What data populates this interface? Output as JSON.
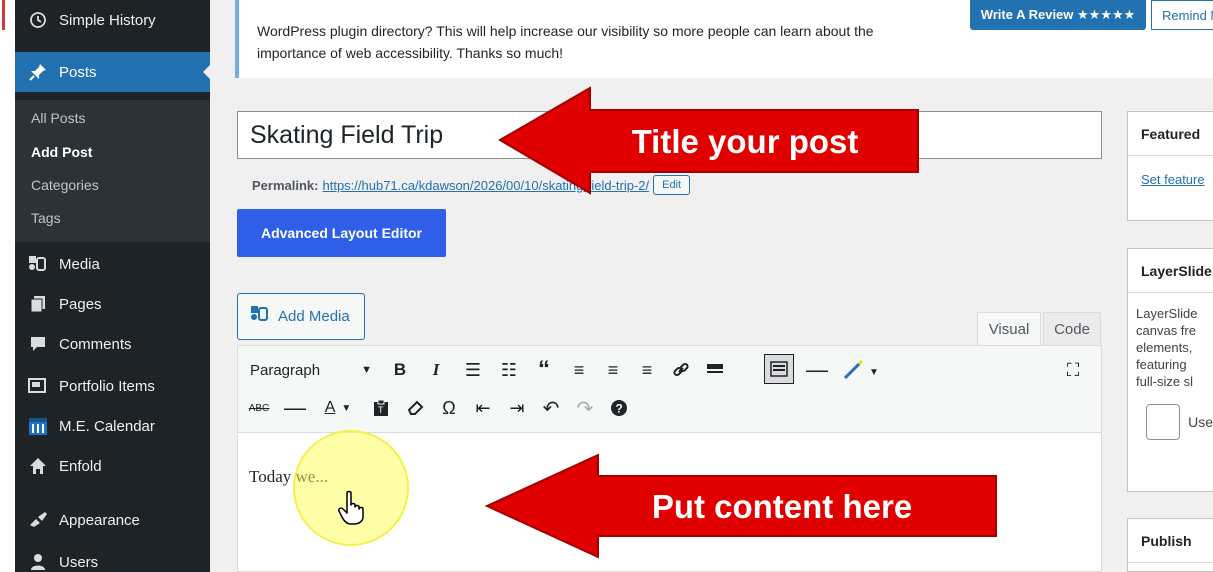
{
  "sidebar": {
    "items": [
      {
        "label": "Simple History",
        "icon": "history-icon"
      },
      {
        "label": "Posts",
        "icon": "pin-icon"
      },
      {
        "label": "Media",
        "icon": "media-icon"
      },
      {
        "label": "Pages",
        "icon": "pages-icon"
      },
      {
        "label": "Comments",
        "icon": "comment-icon"
      },
      {
        "label": "Portfolio Items",
        "icon": "portfolio-icon"
      },
      {
        "label": "M.E. Calendar",
        "icon": "calendar-icon"
      },
      {
        "label": "Enfold",
        "icon": "home-icon"
      },
      {
        "label": "Appearance",
        "icon": "brush-icon"
      },
      {
        "label": "Users",
        "icon": "user-icon"
      }
    ],
    "submenu": [
      "All Posts",
      "Add Post",
      "Categories",
      "Tags"
    ]
  },
  "notice": {
    "text": "WordPress plugin directory? This will help increase our visibility so more people can learn about the importance of web accessibility. Thanks so much!",
    "review_button": "Write A Review ★★★★★",
    "remind_button": "Remind M"
  },
  "editor": {
    "title": "Skating Field Trip",
    "permalink_label": "Permalink:",
    "permalink_url": "https://hub71.ca/kdawson/2026/00/10/skating-field-trip-2/",
    "edit_label": "Edit",
    "advanced_layout_label": "Advanced Layout Editor",
    "add_media_label": "Add Media",
    "tab_visual": "Visual",
    "tab_code": "Code",
    "format_value": "Paragraph",
    "content": "Today we..."
  },
  "right_panels": {
    "featured_title": "Featured",
    "featured_link": "Set feature",
    "layerslider_title": "LayerSlide",
    "layerslider_desc": [
      "LayerSlide",
      "canvas fre",
      "elements,",
      "featuring",
      "full-size sl"
    ],
    "layerslider_check": "Use",
    "publish_title": "Publish"
  },
  "annotations": {
    "title_arrow": "Title your post",
    "content_arrow": "Put content here"
  },
  "colors": {
    "sidebar_bg": "#1d2327",
    "active": "#2271b1",
    "arrow": "#e00000",
    "ale_button": "#2f5fe9"
  }
}
